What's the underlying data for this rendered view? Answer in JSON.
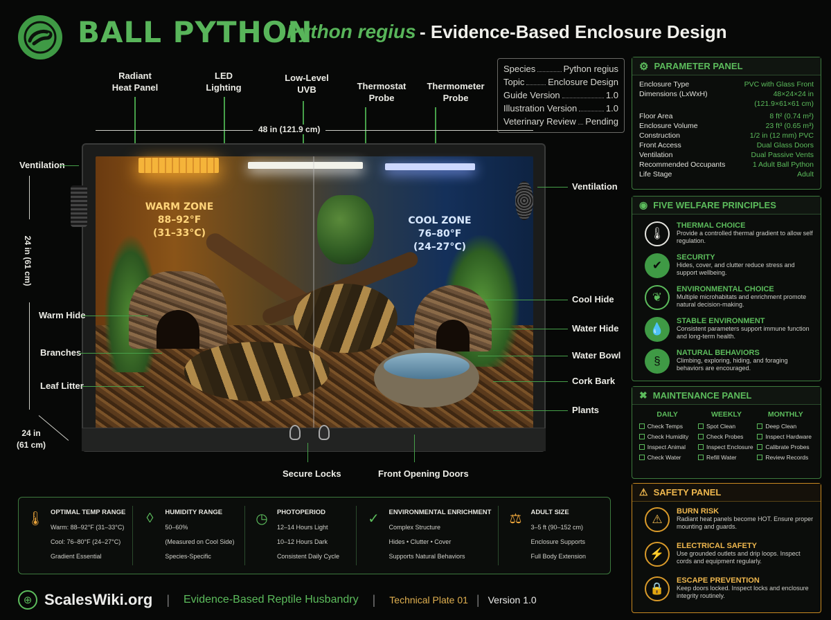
{
  "header": {
    "title_main": "BALL PYTHON",
    "title_scientific": "Python regius",
    "title_rest": "- Evidence-Based Enclosure Design"
  },
  "meta": [
    {
      "key": "Species",
      "value": "Python regius"
    },
    {
      "key": "Topic",
      "value": "Enclosure Design"
    },
    {
      "key": "Guide Version",
      "value": "1.0"
    },
    {
      "key": "Illustration Version",
      "value": "1.0"
    },
    {
      "key": "Veterinary Review",
      "value": "Pending"
    }
  ],
  "top_labels": {
    "heat_panel": "Radiant\nHeat Panel",
    "led": "LED\nLighting",
    "uvb": "Low-Level\nUVB",
    "thermostat": "Thermostat\nProbe",
    "thermometer": "Thermometer\nProbe"
  },
  "dimensions": {
    "width": "48 in (121.9 cm)",
    "height": "24 in (61 cm)",
    "depth": "24 in\n(61 cm)"
  },
  "zones": {
    "warm": "WARM ZONE\n88–92°F\n(31–33°C)",
    "cool": "COOL ZONE\n76–80°F\n(24–27°C)"
  },
  "left_labels": {
    "ventilation": "Ventilation",
    "warm_hide": "Warm Hide",
    "branches": "Branches",
    "leaf_litter": "Leaf Litter"
  },
  "right_labels": {
    "ventilation": "Ventilation",
    "cool_hide": "Cool Hide",
    "water_hide": "Water Hide",
    "water_bowl": "Water Bowl",
    "cork_bark": "Cork Bark",
    "plants": "Plants"
  },
  "bottom_labels": {
    "locks": "Secure Locks",
    "doors": "Front Opening Doors"
  },
  "parameter_panel": {
    "title": "PARAMETER PANEL",
    "rows": [
      {
        "key": "Enclosure Type",
        "value": "PVC with Glass Front"
      },
      {
        "key": "Dimensions (LxWxH)",
        "value": "48×24×24 in"
      },
      {
        "key": "",
        "value": "(121.9×61×61 cm)"
      },
      {
        "key": "Floor Area",
        "value": "8 ft² (0.74 m²)"
      },
      {
        "key": "Enclosure Volume",
        "value": "23 ft³ (0.65 m³)"
      },
      {
        "key": "Construction",
        "value": "1/2 in (12 mm) PVC"
      },
      {
        "key": "Front Access",
        "value": "Dual Glass Doors"
      },
      {
        "key": "Ventilation",
        "value": "Dual Passive Vents"
      },
      {
        "key": "Recommended Occupants",
        "value": "1 Adult Ball Python"
      },
      {
        "key": "Life Stage",
        "value": "Adult"
      }
    ]
  },
  "welfare": {
    "title": "FIVE WELFARE PRINCIPLES",
    "items": [
      {
        "title": "THERMAL CHOICE",
        "desc": "Provide a controlled thermal gradient to allow self regulation.",
        "icon": "thermometer-icon"
      },
      {
        "title": "SECURITY",
        "desc": "Hides, cover, and clutter reduce stress and support wellbeing.",
        "icon": "shield-icon"
      },
      {
        "title": "ENVIRONMENTAL CHOICE",
        "desc": "Multiple microhabitats and enrichment promote natural decision-making.",
        "icon": "leaf-icon"
      },
      {
        "title": "STABLE ENVIRONMENT",
        "desc": "Consistent parameters support immune function and long-term health.",
        "icon": "water-drop-icon"
      },
      {
        "title": "NATURAL BEHAVIORS",
        "desc": "Climbing, exploring, hiding, and foraging behaviors are encouraged.",
        "icon": "snake-icon"
      }
    ]
  },
  "maintenance": {
    "title": "MAINTENANCE PANEL",
    "columns": [
      {
        "head": "DAILY",
        "items": [
          "Check Temps",
          "Check Humidity",
          "Inspect Animal",
          "Check Water"
        ]
      },
      {
        "head": "WEEKLY",
        "items": [
          "Spot Clean",
          "Check Probes",
          "Inspect Enclosure",
          "Refill Water"
        ]
      },
      {
        "head": "MONTHLY",
        "items": [
          "Deep Clean",
          "Inspect Hardware",
          "Calibrate Probes",
          "Review Records"
        ]
      }
    ]
  },
  "safety": {
    "title": "SAFETY PANEL",
    "items": [
      {
        "title": "BURN RISK",
        "desc": "Radiant heat panels become HOT. Ensure proper mounting and guards.",
        "icon": "fire-icon"
      },
      {
        "title": "ELECTRICAL SAFETY",
        "desc": "Use grounded outlets and drip loops. Inspect cords and equipment regularly.",
        "icon": "lightning-icon"
      },
      {
        "title": "ESCAPE PREVENTION",
        "desc": "Keep doors locked. Inspect locks and enclosure integrity routinely.",
        "icon": "lock-icon"
      }
    ]
  },
  "infobar": [
    {
      "title": "OPTIMAL TEMP RANGE",
      "lines": [
        "Warm: 88–92°F (31–33°C)",
        "Cool: 76–80°F (24–27°C)",
        "Gradient Essential"
      ],
      "icon": "thermometer-icon"
    },
    {
      "title": "HUMIDITY RANGE",
      "lines": [
        "50–60%",
        "(Measured on Cool Side)",
        "Species-Specific"
      ],
      "icon": "water-drop-icon"
    },
    {
      "title": "PHOTOPERIOD",
      "lines": [
        "12–14 Hours Light",
        "10–12 Hours Dark",
        "Consistent Daily Cycle"
      ],
      "icon": "clock-icon"
    },
    {
      "title": "ENVIRONMENTAL ENRICHMENT",
      "lines": [
        "Complex Structure",
        "Hides • Clutter • Cover",
        "Supports Natural Behaviors"
      ],
      "icon": "shield-check-icon"
    },
    {
      "title": "ADULT SIZE",
      "lines": [
        "3–5 ft (90–152 cm)",
        "Enclosure Supports",
        "Full Body Extension"
      ],
      "icon": "weight-icon"
    }
  ],
  "footer": {
    "site": "ScalesWiki.org",
    "tagline": "Evidence-Based Reptile Husbandry",
    "plate": "Technical Plate 01",
    "version": "Version 1.0"
  },
  "colors": {
    "accent_green": "#58b55a",
    "safety_orange": "#f0b84e",
    "warm_glow": "#8a5418",
    "cool_glow": "#14305a"
  }
}
